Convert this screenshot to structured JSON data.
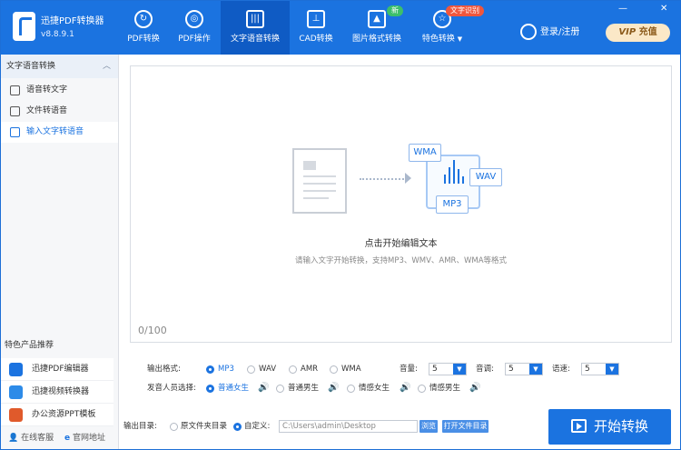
{
  "app": {
    "title": "迅捷PDF转换器",
    "version": "v8.8.9.1"
  },
  "tabs": [
    {
      "label": "PDF转换",
      "icon": "pdf-convert-icon"
    },
    {
      "label": "PDF操作",
      "icon": "pdf-operate-icon"
    },
    {
      "label": "文字语音转换",
      "icon": "waveform-icon",
      "active": true
    },
    {
      "label": "CAD转换",
      "icon": "cad-icon"
    },
    {
      "label": "图片格式转换",
      "icon": "image-icon",
      "badge": "新"
    },
    {
      "label": "特色转换",
      "icon": "star-icon",
      "badge": "文字识别",
      "dropdown": "▼"
    }
  ],
  "header": {
    "login": "登录/注册",
    "vip_label": "VIP",
    "vip_action": "充值"
  },
  "window_controls": {
    "minimize": "—",
    "close": "✕"
  },
  "sidebar": {
    "heading": "文字语音转换",
    "items": [
      {
        "label": "语音转文字",
        "icon": "speech-to-text-icon"
      },
      {
        "label": "文件转语音",
        "icon": "file-to-speech-icon"
      },
      {
        "label": "输入文字转语音",
        "icon": "text-input-icon",
        "active": true
      }
    ],
    "recommend_title": "特色产品推荐",
    "recommend": [
      {
        "label": "迅捷PDF编辑器",
        "color": "#1b73e0"
      },
      {
        "label": "迅捷视频转换器",
        "color": "#2d8be8"
      },
      {
        "label": "办公资源PPT模板",
        "color": "#e05a2b"
      }
    ],
    "footer": {
      "service": "在线客服",
      "website": "官网地址"
    }
  },
  "main": {
    "formats": [
      "WMA",
      "WAV",
      "MP3"
    ],
    "hint_title": "点击开始编辑文本",
    "hint_sub": "请输入文字开始转换，支持MP3、WMV、AMR、WMA等格式",
    "counter": "0/100"
  },
  "options": {
    "format_label": "输出格式:",
    "format_choices": [
      "MP3",
      "WAV",
      "AMR",
      "WMA"
    ],
    "format_selected": "MP3",
    "volume_label": "音量:",
    "volume": "5",
    "pitch_label": "音调:",
    "pitch": "5",
    "speed_label": "语速:",
    "speed": "5",
    "voice_label": "发音人员选择:",
    "voices": [
      "普通女生",
      "普通男生",
      "情感女生",
      "情感男生"
    ],
    "voice_selected": "普通女生"
  },
  "output": {
    "label": "输出目录:",
    "original": "原文件夹目录",
    "custom": "自定义:",
    "path": "C:\\Users\\admin\\Desktop",
    "browse": "浏览",
    "open": "打开文件目录"
  },
  "start_button": "开始转换",
  "colors": {
    "primary": "#1b73e0",
    "topbar": "#1b73e0",
    "active_tab": "#0f5bc4"
  }
}
